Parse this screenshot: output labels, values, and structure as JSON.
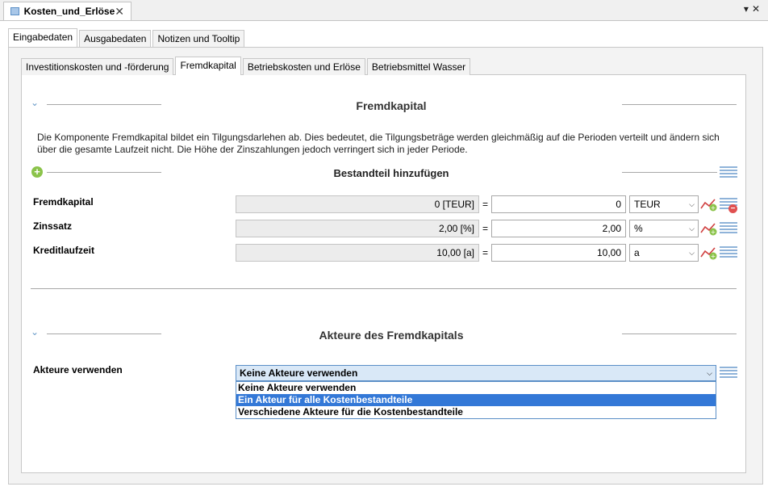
{
  "view_tab": {
    "title": "Kosten_und_Erlöse",
    "close": "✕"
  },
  "window_controls": "▾✕",
  "outer_tabs": [
    "Eingabedaten",
    "Ausgabedaten",
    "Notizen und Tooltip"
  ],
  "inner_tabs": [
    "Investitionskosten und -förderung",
    "Fremdkapital",
    "Betriebskosten und Erlöse",
    "Betriebsmittel Wasser"
  ],
  "fremdkapital": {
    "title": "Fremdkapital",
    "description": "Die Komponente Fremdkapital bildet ein Tilgungsdarlehen ab. Dies bedeutet, die Tilgungsbeträge werden gleichmäßig auf die Perioden verteilt und ändern sich über die gesamte Laufzeit nicht. Die Höhe der Zinszahlungen jedoch verringert sich in jeder Periode.",
    "add_component": "Bestandteil hinzufügen",
    "rows": [
      {
        "label": "Fremdkapital",
        "computed": "0 [TEUR]",
        "eq": "=",
        "value": "0",
        "unit": "TEUR"
      },
      {
        "label": "Zinssatz",
        "computed": "2,00 [%]",
        "eq": "=",
        "value": "2,00",
        "unit": "%"
      },
      {
        "label": "Kreditlaufzeit",
        "computed": "10,00 [a]",
        "eq": "=",
        "value": "10,00",
        "unit": "a"
      }
    ]
  },
  "akteure": {
    "title": "Akteure des Fremdkapitals",
    "label": "Akteure verwenden",
    "selected": "Keine Akteure verwenden",
    "options": [
      "Keine Akteure verwenden",
      "Ein Akteur für alle Kostenbestandteile",
      "Verschiedene Akteure für die Kostenbestandteile"
    ],
    "highlighted_index": 1
  },
  "colors": {
    "accent": "#3378d7",
    "add_green": "#8bc34a",
    "remove_red": "#e05050"
  }
}
